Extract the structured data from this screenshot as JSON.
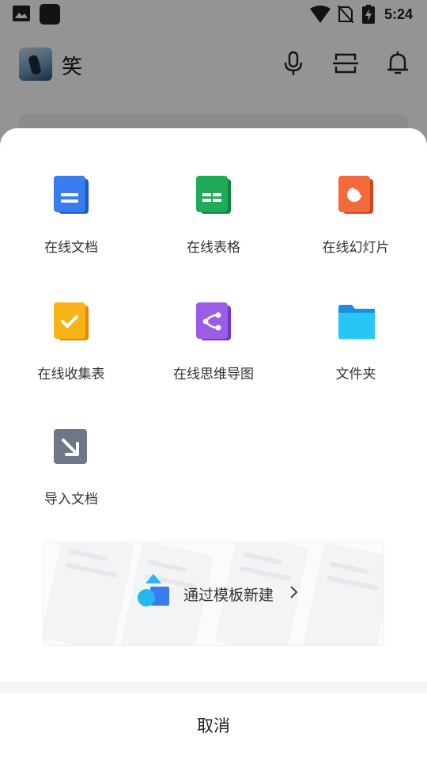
{
  "status_bar": {
    "time": "5:24"
  },
  "header": {
    "user_name": "笑"
  },
  "sheet": {
    "items": [
      {
        "label": "在线文档",
        "icon": "online-doc-icon"
      },
      {
        "label": "在线表格",
        "icon": "online-sheet-icon"
      },
      {
        "label": "在线幻灯片",
        "icon": "online-slides-icon"
      },
      {
        "label": "在线收集表",
        "icon": "online-form-icon"
      },
      {
        "label": "在线思维导图",
        "icon": "online-mindmap-icon"
      },
      {
        "label": "文件夹",
        "icon": "folder-icon"
      },
      {
        "label": "导入文档",
        "icon": "import-doc-icon"
      }
    ],
    "template_banner": {
      "label": "通过模板新建"
    },
    "cancel_label": "取消"
  },
  "colors": {
    "doc_blue": "#3a7bf0",
    "sheet_green": "#1fab5a",
    "slides_orange": "#f06a3a",
    "form_yellow": "#f7b41a",
    "mindmap_purple": "#9b5de8",
    "folder_cyan": "#27b6f2",
    "import_gray": "#6e7787"
  }
}
